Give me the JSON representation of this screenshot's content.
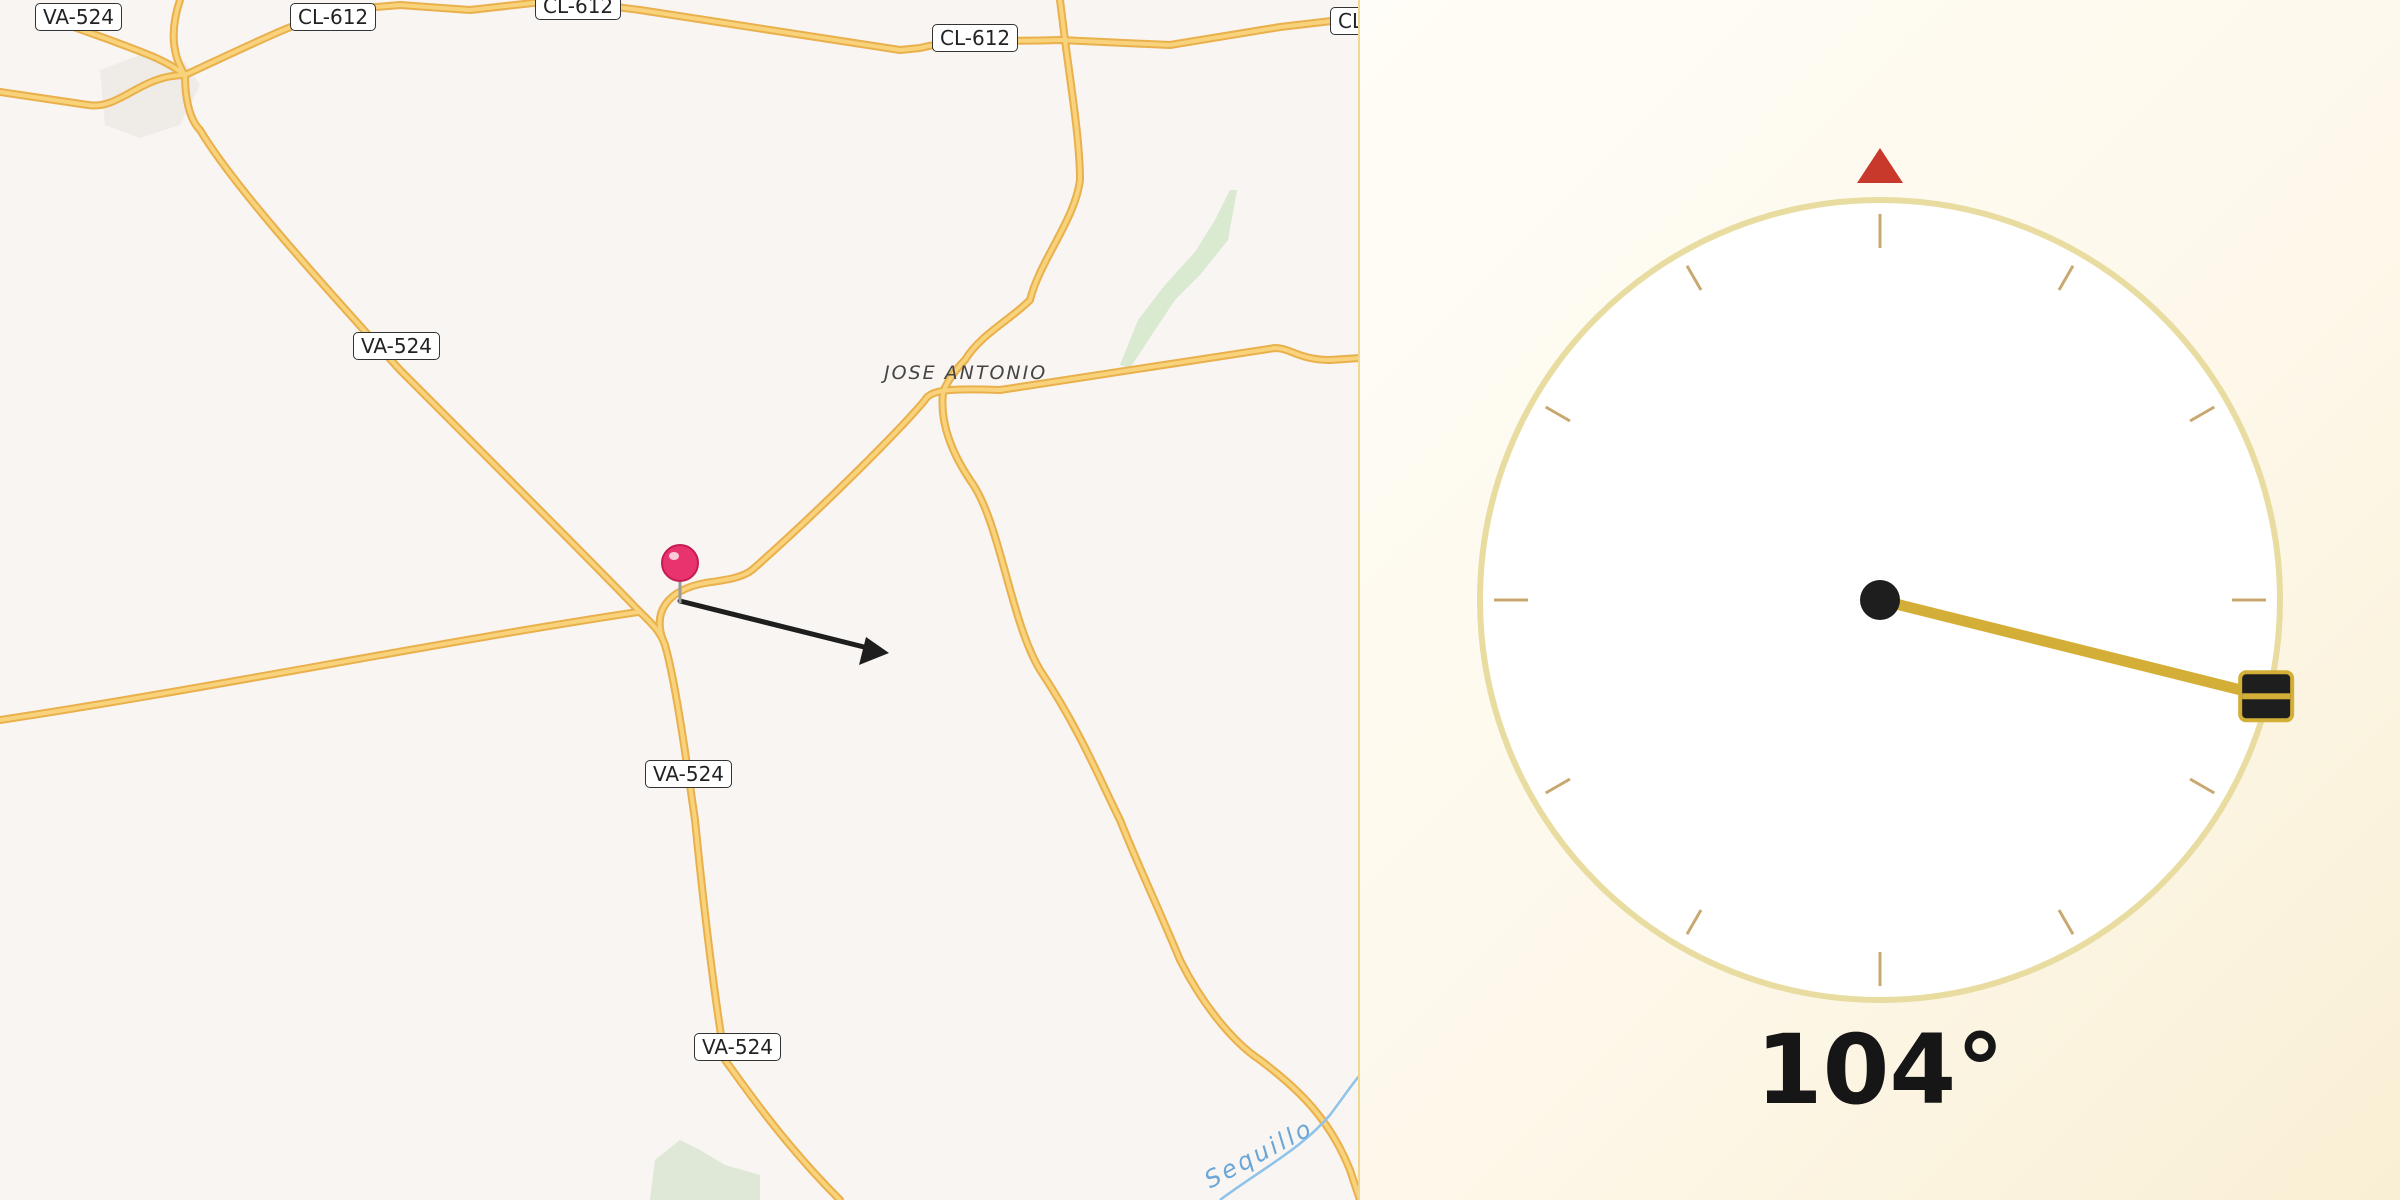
{
  "map": {
    "road_labels": [
      {
        "id": "va524-top-left",
        "text": "VA-524"
      },
      {
        "id": "cl612-top-1",
        "text": "CL-612"
      },
      {
        "id": "cl612-top-2",
        "text": "CL-612"
      },
      {
        "id": "cl612-top-3",
        "text": "CL-612"
      },
      {
        "id": "cl-edge",
        "text": "CL"
      },
      {
        "id": "va524-mid",
        "text": "VA-524"
      },
      {
        "id": "va524-south",
        "text": "VA-524"
      },
      {
        "id": "va524-bottom",
        "text": "VA-524"
      }
    ],
    "place_label": "JOSE ANTONIO",
    "water_label": "Sequillo",
    "colors": {
      "road": "#f5c96a",
      "road_casing": "#e9b04c",
      "background": "#f8f5f2",
      "pin": "#e8336e",
      "river": "#8fc3ea",
      "park": "#d9ead0"
    },
    "marker": {
      "icon": "map-pin-icon"
    },
    "direction_arrow": {
      "icon": "direction-arrow-icon",
      "bearing_deg": 104
    }
  },
  "compass": {
    "heading_deg": 104,
    "heading_text": "104°",
    "north_marker_color": "#c8392b",
    "needle_color": "#d4af37",
    "dial_color": "#e8dca0",
    "tick_color": "#c8a870"
  }
}
